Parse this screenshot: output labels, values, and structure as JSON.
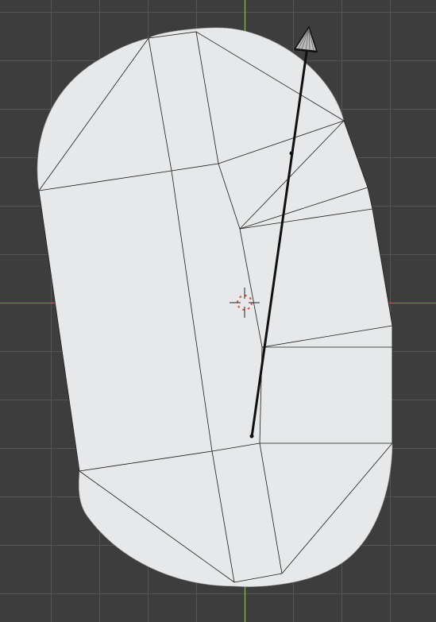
{
  "viewport": {
    "view": "top-orthographic",
    "background_color": "#3d3d3d",
    "grid_color": "#545454",
    "x_axis_color": "#c8515d",
    "y_axis_color": "#8cc03a"
  },
  "mesh": {
    "face_color": "#e7e8e9",
    "edge_color": "#1c1c1c",
    "shading": "solid"
  },
  "origin_marker": {
    "icon": "3d-cursor-icon",
    "colors": [
      "#d85a4f",
      "#f0f0f0"
    ]
  },
  "annotation": {
    "type": "arrow",
    "color": "#101010",
    "head_icon": "cone-arrow-head-icon"
  }
}
